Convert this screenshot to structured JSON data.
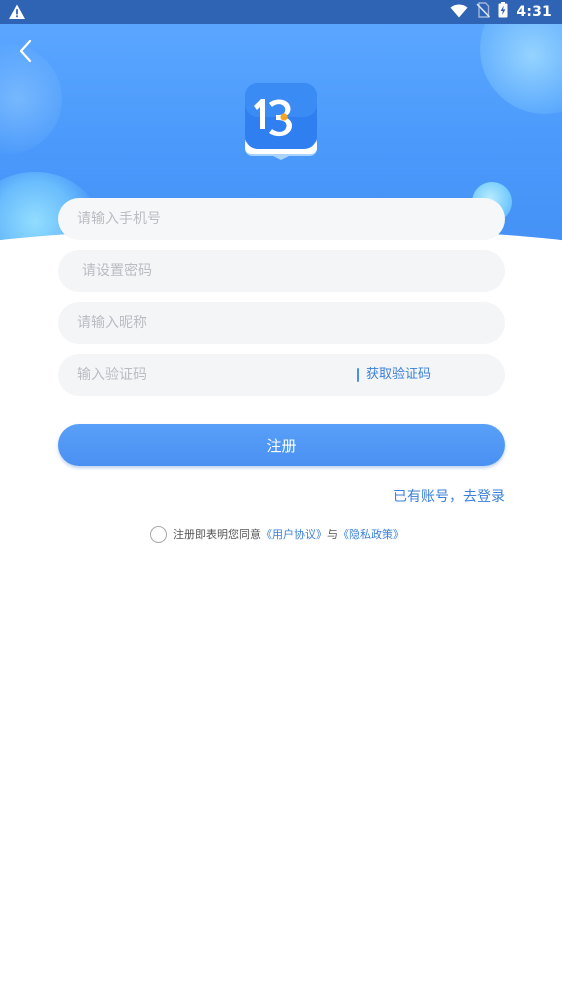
{
  "status_bar": {
    "time": "4:31",
    "icons": [
      "warning-icon",
      "wifi-icon",
      "no-sim-icon",
      "battery-charging-icon"
    ]
  },
  "header": {
    "back_icon": "chevron-left-icon",
    "logo_icon": "app-logo-icon"
  },
  "form": {
    "phone_placeholder": "请输入手机号",
    "password_placeholder": "请设置密码",
    "nickname_placeholder": "请输入昵称",
    "code_placeholder": "输入验证码",
    "get_code_label": "获取验证码"
  },
  "actions": {
    "register_label": "注册",
    "login_link": "已有账号，去登录"
  },
  "agreement": {
    "prefix": "注册即表明您同意",
    "user_agreement": "《用户协议》",
    "conjunction": "与",
    "privacy_policy": "《隐私政策》"
  },
  "colors": {
    "status_bar": "#2f63b3",
    "header_blue": "#4a99fb",
    "accent": "#3a7fd9",
    "input_bg": "#f4f5f7",
    "placeholder": "#b9bcc2"
  }
}
